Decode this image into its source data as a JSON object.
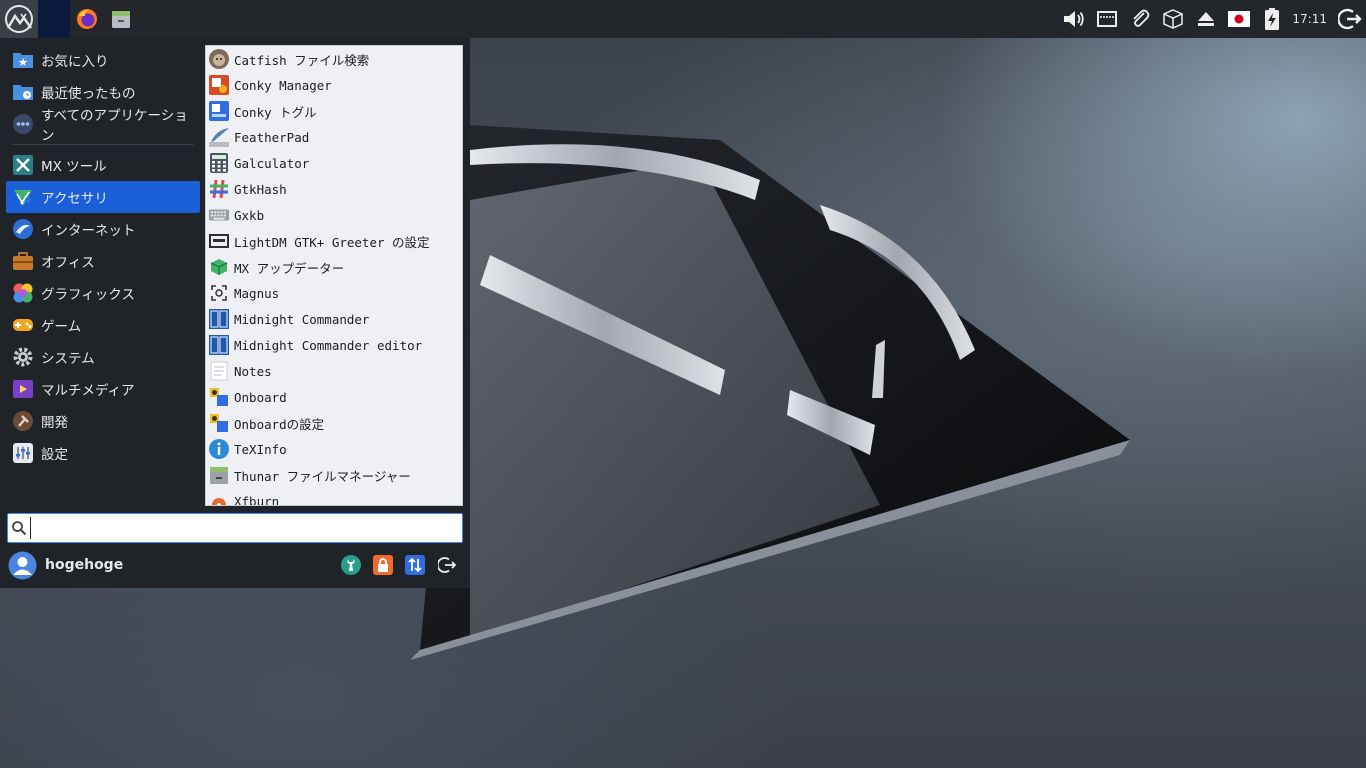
{
  "panel": {
    "menu_icon": "mx-logo-icon",
    "launchers": [
      {
        "name": "firefox",
        "icon": "firefox-icon"
      },
      {
        "name": "file-manager",
        "icon": "file-cabinet-icon"
      }
    ],
    "tray_icons": [
      "volume-icon",
      "network-icon",
      "clipboard-icon",
      "package-icon",
      "eject-icon",
      "japan-flag-icon",
      "battery-charging-icon"
    ],
    "clock": "17:11",
    "logout_icon": "logout-icon"
  },
  "menu": {
    "categories": [
      {
        "label": "お気に入り",
        "icon": "favorites-folder-icon"
      },
      {
        "label": "最近使ったもの",
        "icon": "recent-folder-icon"
      },
      {
        "label": "すべてのアプリケーション",
        "icon": "all-apps-icon"
      },
      {
        "label": "MX ツール",
        "icon": "mx-tools-icon"
      },
      {
        "label": "アクセサリ",
        "icon": "accessories-icon",
        "active": true
      },
      {
        "label": "インターネット",
        "icon": "internet-icon"
      },
      {
        "label": "オフィス",
        "icon": "office-icon"
      },
      {
        "label": "グラフィックス",
        "icon": "graphics-icon"
      },
      {
        "label": "ゲーム",
        "icon": "games-icon"
      },
      {
        "label": "システム",
        "icon": "system-icon"
      },
      {
        "label": "マルチメディア",
        "icon": "multimedia-icon"
      },
      {
        "label": "開発",
        "icon": "development-icon"
      },
      {
        "label": "設定",
        "icon": "settings-icon"
      }
    ],
    "apps": [
      {
        "label": "Catfish ファイル検索",
        "icon": "catfish-icon"
      },
      {
        "label": "Conky Manager",
        "icon": "conky-manager-icon"
      },
      {
        "label": "Conky トグル",
        "icon": "conky-toggle-icon"
      },
      {
        "label": "FeatherPad",
        "icon": "featherpad-icon"
      },
      {
        "label": "Galculator",
        "icon": "calculator-icon"
      },
      {
        "label": "GtkHash",
        "icon": "gtkhash-icon"
      },
      {
        "label": "Gxkb",
        "icon": "keyboard-icon"
      },
      {
        "label": "LightDM GTK+ Greeter の設定",
        "icon": "lightdm-icon"
      },
      {
        "label": "MX アップデーター",
        "icon": "mx-updater-icon"
      },
      {
        "label": "Magnus",
        "icon": "magnifier-icon"
      },
      {
        "label": "Midnight Commander",
        "icon": "midnight-commander-icon"
      },
      {
        "label": "Midnight Commander editor",
        "icon": "midnight-commander-editor-icon"
      },
      {
        "label": "Notes",
        "icon": "notes-icon"
      },
      {
        "label": "Onboard",
        "icon": "onboard-icon"
      },
      {
        "label": "Onboardの設定",
        "icon": "onboard-settings-icon"
      },
      {
        "label": "TeXInfo",
        "icon": "info-icon"
      },
      {
        "label": "Thunar ファイルマネージャー",
        "icon": "thunar-icon"
      },
      {
        "label": "Xfburn",
        "icon": "xfburn-icon"
      }
    ],
    "search": {
      "value": "",
      "placeholder": "",
      "icon": "search-icon"
    },
    "user": {
      "name": "hogehoge",
      "avatar_icon": "user-avatar-icon"
    },
    "actions": [
      {
        "name": "settings-manager",
        "icon": "wrench-icon"
      },
      {
        "name": "lock-screen",
        "icon": "lock-icon"
      },
      {
        "name": "switch-user",
        "icon": "switch-user-icon"
      },
      {
        "name": "log-out",
        "icon": "logout-icon"
      }
    ]
  },
  "colors": {
    "panel_bg": "#23262b",
    "menu_bg": "#202328",
    "accent": "#1a5fd8",
    "app_list_bg": "#eef0f4"
  }
}
